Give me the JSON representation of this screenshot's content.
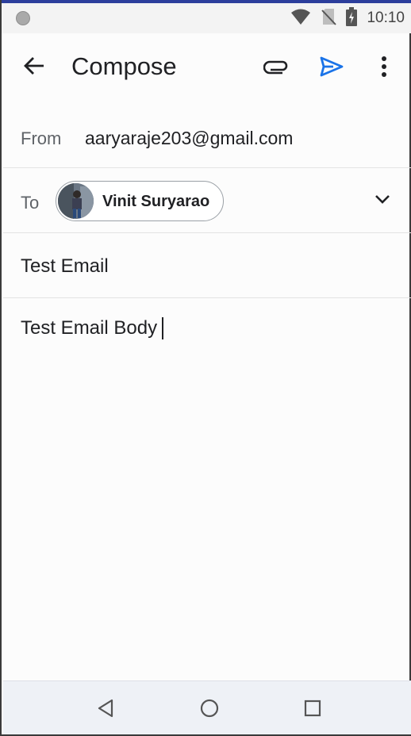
{
  "status_bar": {
    "time": "10:10",
    "icons": [
      "notification-dot-icon",
      "wifi-icon",
      "no-sim-icon",
      "battery-charging-icon"
    ]
  },
  "app_bar": {
    "title": "Compose",
    "icons": [
      "back-arrow-icon",
      "attachment-icon",
      "send-icon",
      "more-vert-icon"
    ],
    "accent_color": "#1a73e8"
  },
  "from": {
    "label": "From",
    "value": "aaryaraje203@gmail.com"
  },
  "to": {
    "label": "To",
    "recipients": [
      {
        "name": "Vinit Suryarao"
      }
    ],
    "expand_icon": "chevron-down-icon"
  },
  "subject": {
    "value": "Test Email"
  },
  "body": {
    "value": "Test Email Body"
  },
  "nav_bar": {
    "icons": [
      "nav-back-icon",
      "nav-home-icon",
      "nav-recents-icon"
    ]
  }
}
